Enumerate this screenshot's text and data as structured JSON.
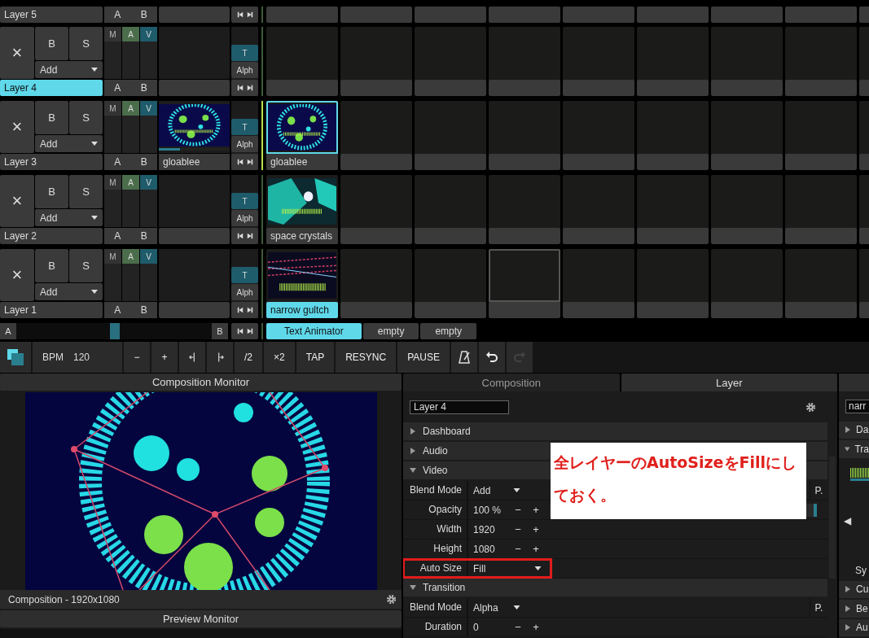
{
  "top_layer": {
    "name": "Layer 5",
    "crossfade": [
      "A",
      "B"
    ]
  },
  "layers": [
    {
      "name": "Layer 4",
      "selected": true,
      "close": "×",
      "bypass": "B",
      "solo": "S",
      "add": "Add",
      "mav": [
        {
          "label": "M",
          "on": false
        },
        {
          "label": "A",
          "on": true
        },
        {
          "label": "V",
          "on": true
        }
      ],
      "crossfade": [
        "A",
        "B"
      ],
      "transition": "T",
      "blend": "Alph",
      "clips": [
        {
          "kind": "empty",
          "outlined": false
        },
        {
          "kind": "empty",
          "outlined": false
        },
        {
          "kind": "empty",
          "outlined": false
        },
        {
          "kind": "empty",
          "outlined": false
        },
        {
          "kind": "empty",
          "outlined": false
        },
        {
          "kind": "empty",
          "outlined": false
        },
        {
          "kind": "empty",
          "outlined": false
        },
        {
          "kind": "empty",
          "outlined": false
        },
        {
          "kind": "empty",
          "outlined": false
        }
      ]
    },
    {
      "name": "Layer 3",
      "selected": false,
      "close": "×",
      "bypass": "B",
      "solo": "S",
      "add": "Add",
      "mav": [
        {
          "label": "M",
          "on": false
        },
        {
          "label": "A",
          "on": true
        },
        {
          "label": "V",
          "on": true
        }
      ],
      "crossfade": [
        "A",
        "B"
      ],
      "transition": "T",
      "blend": "Alph",
      "active_clip": {
        "name": "gloablee",
        "kind": "globe",
        "level": 0.3
      },
      "clips": [
        {
          "kind": "globe",
          "name": "gloablee",
          "selected": true,
          "playing": false
        },
        {
          "kind": "empty",
          "outlined": false
        },
        {
          "kind": "empty",
          "outlined": false
        },
        {
          "kind": "empty",
          "outlined": false
        },
        {
          "kind": "empty",
          "outlined": false
        },
        {
          "kind": "empty",
          "outlined": false
        },
        {
          "kind": "empty",
          "outlined": false
        },
        {
          "kind": "empty",
          "outlined": false
        },
        {
          "kind": "empty",
          "outlined": false
        }
      ]
    },
    {
      "name": "Layer 2",
      "selected": false,
      "close": "×",
      "bypass": "B",
      "solo": "S",
      "add": "Add",
      "mav": [
        {
          "label": "M",
          "on": false
        },
        {
          "label": "A",
          "on": true
        },
        {
          "label": "V",
          "on": true
        }
      ],
      "crossfade": [
        "A",
        "B"
      ],
      "transition": "T",
      "blend": "Alph",
      "clips": [
        {
          "kind": "crystals",
          "name": "space crystals",
          "selected": false,
          "playing": false
        },
        {
          "kind": "empty",
          "outlined": false
        },
        {
          "kind": "empty",
          "outlined": false
        },
        {
          "kind": "empty",
          "outlined": false
        },
        {
          "kind": "empty",
          "outlined": false
        },
        {
          "kind": "empty",
          "outlined": false
        },
        {
          "kind": "empty",
          "outlined": false
        },
        {
          "kind": "empty",
          "outlined": false
        },
        {
          "kind": "empty",
          "outlined": false
        }
      ]
    },
    {
      "name": "Layer 1",
      "selected": false,
      "close": "×",
      "bypass": "B",
      "solo": "S",
      "add": "Add",
      "mav": [
        {
          "label": "M",
          "on": false
        },
        {
          "label": "A",
          "on": true
        },
        {
          "label": "V",
          "on": true
        }
      ],
      "crossfade": [
        "A",
        "B"
      ],
      "transition": "T",
      "blend": "Alph",
      "clips": [
        {
          "kind": "streaks",
          "name": "narrow gultch",
          "selected": false,
          "playing": true
        },
        {
          "kind": "empty",
          "outlined": false
        },
        {
          "kind": "empty",
          "outlined": false
        },
        {
          "kind": "empty",
          "outlined": true
        },
        {
          "kind": "empty",
          "outlined": false
        },
        {
          "kind": "empty",
          "outlined": false
        },
        {
          "kind": "empty",
          "outlined": false
        },
        {
          "kind": "empty",
          "outlined": false
        },
        {
          "kind": "empty",
          "outlined": false
        }
      ]
    }
  ],
  "crossfader": {
    "a": "A",
    "b": "B",
    "level": 0.48
  },
  "decks": [
    {
      "label": "Text Animator",
      "selected": true
    },
    {
      "label": "empty",
      "selected": false
    },
    {
      "label": "empty",
      "selected": false
    }
  ],
  "toolbar": {
    "bpm_label": "BPM",
    "bpm": "120",
    "buttons_left": [
      "−",
      "+"
    ],
    "buttons_mid": [
      "/2",
      "×2",
      "TAP",
      "RESYNC",
      "PAUSE"
    ],
    "redo_disabled": true
  },
  "monitor": {
    "title": "Composition Monitor",
    "footer": "Composition - 1920x1080",
    "preview_title": "Preview Monitor"
  },
  "inspector": {
    "tabs": [
      {
        "label": "Composition",
        "selected": false
      },
      {
        "label": "Layer",
        "selected": true
      }
    ],
    "name": "Layer 4",
    "rows": [
      {
        "kind": "section",
        "label": "Dashboard",
        "expanded": false
      },
      {
        "kind": "section",
        "label": "Audio",
        "expanded": false
      },
      {
        "kind": "section",
        "label": "Video",
        "expanded": true
      },
      {
        "kind": "dropdown",
        "label": "Blend Mode",
        "value": "Add",
        "extra": "P.",
        "highlighted": false
      },
      {
        "kind": "slider",
        "label": "Opacity",
        "value": "100 %",
        "minus": "−",
        "plus": "+",
        "level": 1,
        "highlighted": false
      },
      {
        "kind": "number",
        "label": "Width",
        "value": "1920",
        "minus": "−",
        "plus": "+",
        "highlighted": false
      },
      {
        "kind": "number",
        "label": "Height",
        "value": "1080",
        "minus": "−",
        "plus": "+",
        "highlighted": false
      },
      {
        "kind": "dropdown",
        "label": "Auto Size",
        "value": "Fill",
        "highlighted": true
      },
      {
        "kind": "section",
        "label": "Transition",
        "expanded": true
      },
      {
        "kind": "dropdown",
        "label": "Blend Mode",
        "value": "Alpha",
        "extra": "P.",
        "highlighted": false
      },
      {
        "kind": "number",
        "label": "Duration",
        "value": "0",
        "minus": "−",
        "plus": "+",
        "highlighted": false
      }
    ]
  },
  "annotation": {
    "text": "全レイヤーのAutoSizeをFillにしておく。"
  },
  "right_panel": {
    "name": "narr",
    "rows": [
      {
        "kind": "section",
        "label": "Da",
        "expanded": false
      },
      {
        "kind": "section",
        "label": "Tra",
        "expanded": true
      },
      {
        "kind": "thumbnail"
      },
      {
        "kind": "arrow",
        "label": "◀"
      },
      {
        "kind": "label",
        "label": "Sy"
      },
      {
        "kind": "section",
        "label": "Cu",
        "expanded": false
      },
      {
        "kind": "section",
        "label": "Be",
        "expanded": false
      },
      {
        "kind": "section",
        "label": "Au",
        "expanded": false
      }
    ]
  }
}
